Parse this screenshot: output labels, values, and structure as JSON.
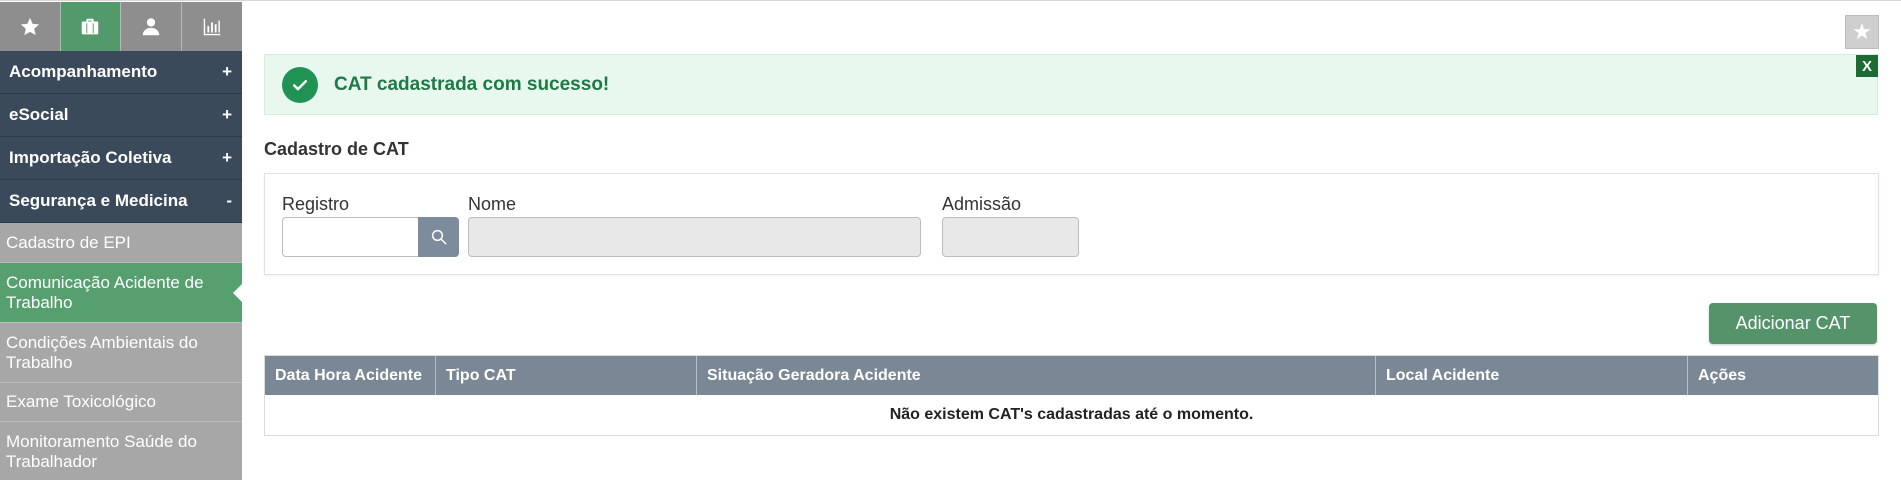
{
  "sidebar": {
    "tabs": [
      {
        "icon": "star-icon",
        "active": false
      },
      {
        "icon": "briefcase-icon",
        "active": true
      },
      {
        "icon": "user-icon",
        "active": false
      },
      {
        "icon": "chart-icon",
        "active": false
      }
    ],
    "groups": [
      {
        "label": "Acompanhamento",
        "sign": "+"
      },
      {
        "label": "eSocial",
        "sign": "+"
      },
      {
        "label": "Importação Coletiva",
        "sign": "+"
      },
      {
        "label": "Segurança e Medicina",
        "sign": "-"
      }
    ],
    "items": [
      {
        "label": "Cadastro de EPI"
      },
      {
        "label": "Comunicação Acidente de Trabalho"
      },
      {
        "label": "Condições Ambientais do Trabalho"
      },
      {
        "label": "Exame Toxicológico"
      },
      {
        "label": "Monitoramento Saúde do Trabalhador"
      }
    ]
  },
  "alert": {
    "message": "CAT cadastrada com sucesso!",
    "close_label": "X"
  },
  "section": {
    "title": "Cadastro de CAT"
  },
  "form": {
    "registro_label": "Registro",
    "registro_value": "",
    "nome_label": "Nome",
    "nome_value": "",
    "admissao_label": "Admissão",
    "admissao_value": ""
  },
  "actions": {
    "add_label": "Adicionar CAT"
  },
  "table": {
    "columns": [
      "Data Hora Acidente",
      "Tipo CAT",
      "Situação Geradora Acidente",
      "Local Acidente",
      "Ações"
    ],
    "empty_message": "Não existem CAT's cadastradas até o momento."
  },
  "colors": {
    "sidebar_dark": "#3a4a5a",
    "accent_green": "#55946a",
    "alert_bg": "#e8f8ee",
    "table_header": "#7a8896"
  }
}
